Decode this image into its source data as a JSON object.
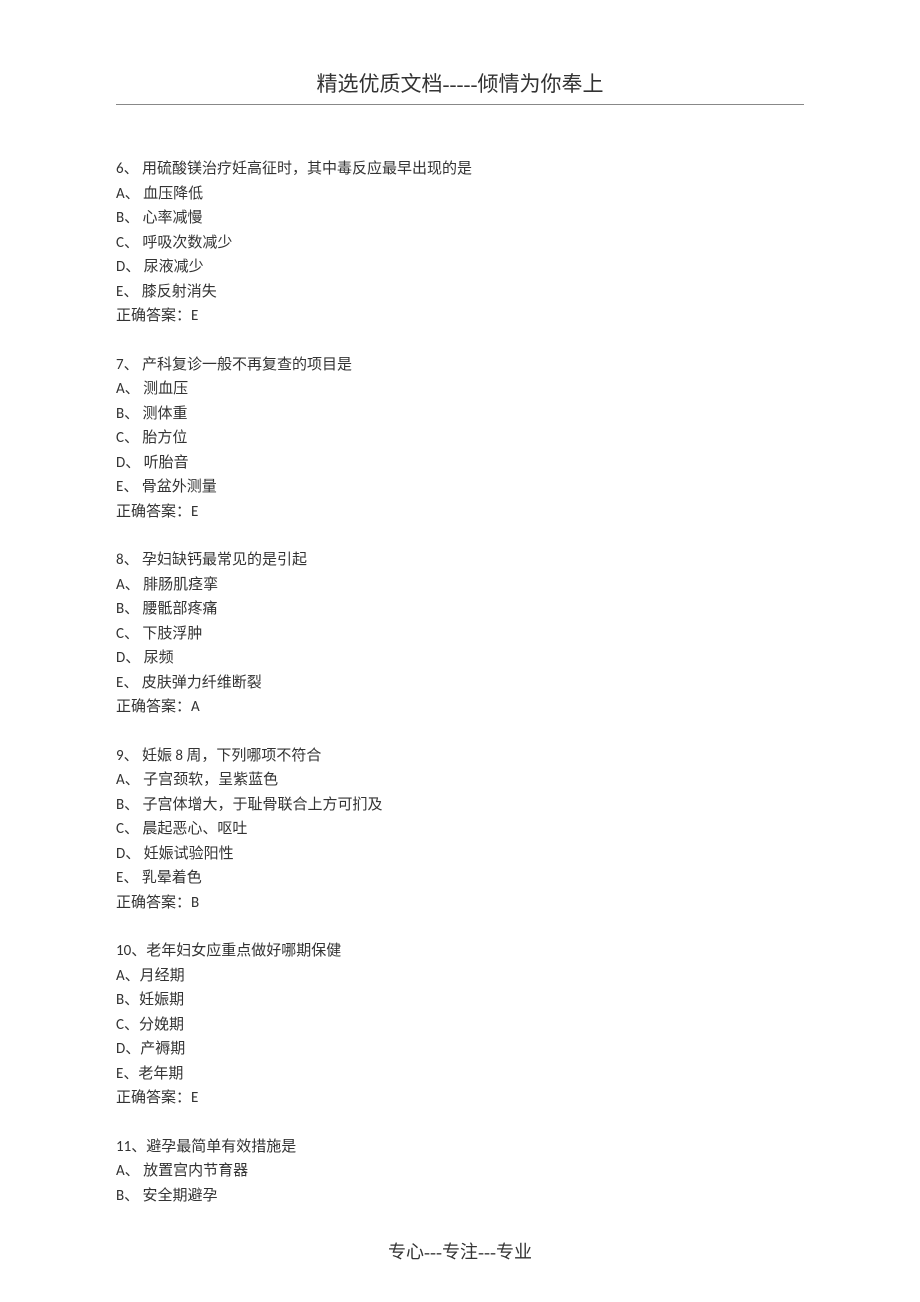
{
  "header": "精选优质文档-----倾情为你奉上",
  "footer": "专心---专注---专业",
  "questions": [
    {
      "number": "6、",
      "text": "用硫酸镁治疗妊高征时，其中毒反应最早出现的是",
      "options": [
        "A、   血压降低",
        "B、   心率减慢",
        "C、   呼吸次数减少",
        "D、   尿液减少",
        "E、   膝反射消失"
      ],
      "answer": "正确答案：E"
    },
    {
      "number": "7、",
      "text": "产科复诊一般不再复查的项目是",
      "options": [
        "A、   测血压",
        "B、   测体重",
        "C、   胎方位",
        "D、   听胎音",
        "E、   骨盆外测量"
      ],
      "answer": "正确答案：E"
    },
    {
      "number": "8、",
      "text": "孕妇缺钙最常见的是引起",
      "options": [
        "A、   腓肠肌痉挛",
        "B、   腰骶部疼痛",
        "C、   下肢浮肿",
        "D、   尿频",
        "E、   皮肤弹力纤维断裂"
      ],
      "answer": "正确答案：A"
    },
    {
      "number": "9、",
      "text": "妊娠 8 周，下列哪项不符合",
      "options": [
        "A、   子宫颈软，呈紫蓝色",
        "B、   子宫体增大，于耻骨联合上方可扪及",
        "C、   晨起恶心、呕吐",
        "D、   妊娠试验阳性",
        "E、   乳晕着色"
      ],
      "answer": "正确答案：B"
    },
    {
      "number": "10、",
      "text": "老年妇女应重点做好哪期保健",
      "options": [
        "A、月经期",
        "B、妊娠期",
        "C、分娩期",
        "D、产褥期",
        "E、老年期"
      ],
      "answer": "正确答案：E"
    },
    {
      "number": "11、",
      "text": "避孕最简单有效措施是",
      "options": [
        "A、  放置宫内节育器",
        "B、  安全期避孕"
      ],
      "answer": ""
    }
  ]
}
